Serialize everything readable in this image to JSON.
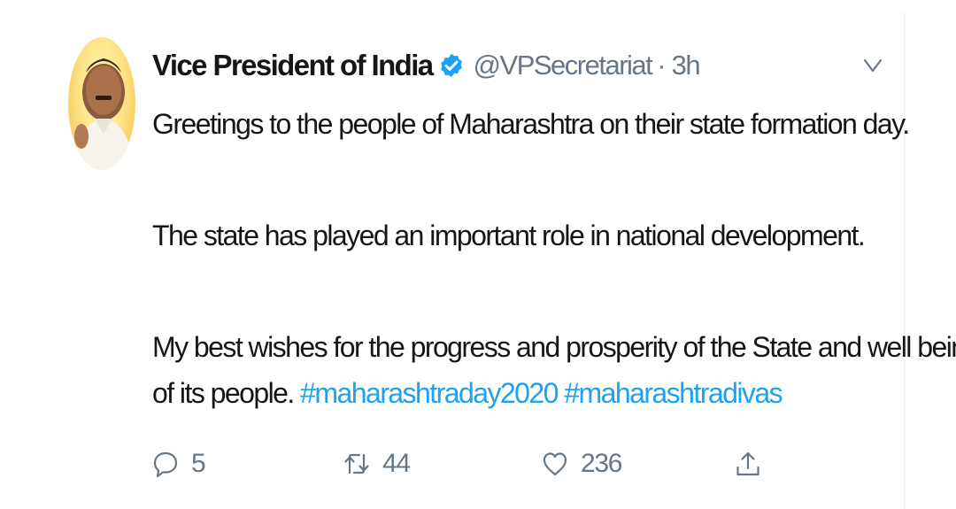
{
  "tweet": {
    "author": {
      "display_name": "Vice President of India",
      "handle": "@VPSecretariat",
      "separator": "·",
      "time": "3h",
      "verified": true,
      "avatar_icon": "profile-photo"
    },
    "body": {
      "paragraph_1": "Greetings to the people of Maharashtra on their state formation day.",
      "paragraph_2": "The state has played an important role in national development.",
      "paragraph_3_line_1": "My best wishes for the progress and prosperity of the State and well being",
      "paragraph_3_line_2": "of its people.",
      "hashtags": [
        "#maharashtraday2020",
        "#maharashtradivas"
      ]
    },
    "actions": {
      "reply": {
        "icon": "reply-icon",
        "count": "5"
      },
      "retweet": {
        "icon": "retweet-icon",
        "count": "44"
      },
      "like": {
        "icon": "heart-icon",
        "count": "236"
      },
      "share": {
        "icon": "share-icon"
      }
    },
    "menu_icon": "chevron-down-icon"
  },
  "colors": {
    "text": "#14171a",
    "secondary": "#657786",
    "link": "#1da1f2",
    "verified": "#1da1f2"
  }
}
